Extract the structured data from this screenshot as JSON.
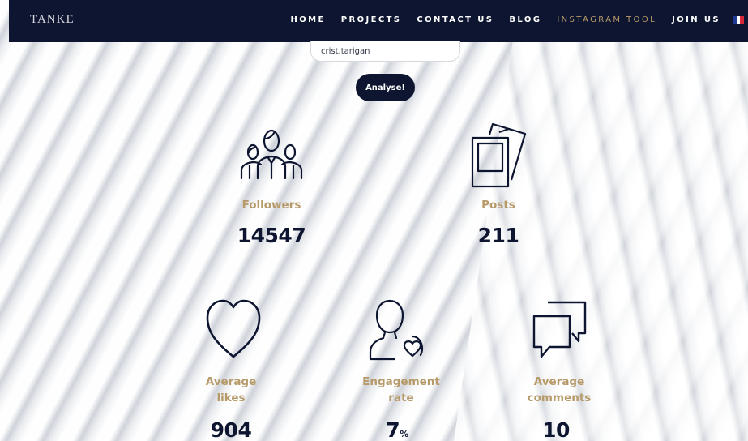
{
  "navbar": {
    "logo": "TANKE",
    "items": [
      "HOME",
      "PROJECTS",
      "CONTACT US",
      "BLOG",
      "INSTAGRAM TOOL",
      "JOIN US"
    ],
    "active_item": "INSTAGRAM TOOL",
    "flag_colors": [
      "#1f3a93",
      "#ffffff",
      "#d62839"
    ]
  },
  "search": {
    "value": "crist.tarigan",
    "button_label": "Analyse!"
  },
  "stats": {
    "followers": {
      "label": "Followers",
      "value": "14547",
      "icon": "followers-icon"
    },
    "posts": {
      "label": "Posts",
      "value": "211",
      "icon": "photos-icon"
    },
    "likes": {
      "label": "Average\nlikes",
      "value": "904",
      "icon": "heart-icon"
    },
    "engagement": {
      "label": "Engagement\nrate",
      "value": "7",
      "unit": "%",
      "icon": "engagement-icon"
    },
    "comments": {
      "label": "Average\ncomments",
      "value": "10",
      "icon": "comments-icon"
    }
  },
  "colors": {
    "navy": "#0d1530",
    "gold": "#b79a6a"
  }
}
